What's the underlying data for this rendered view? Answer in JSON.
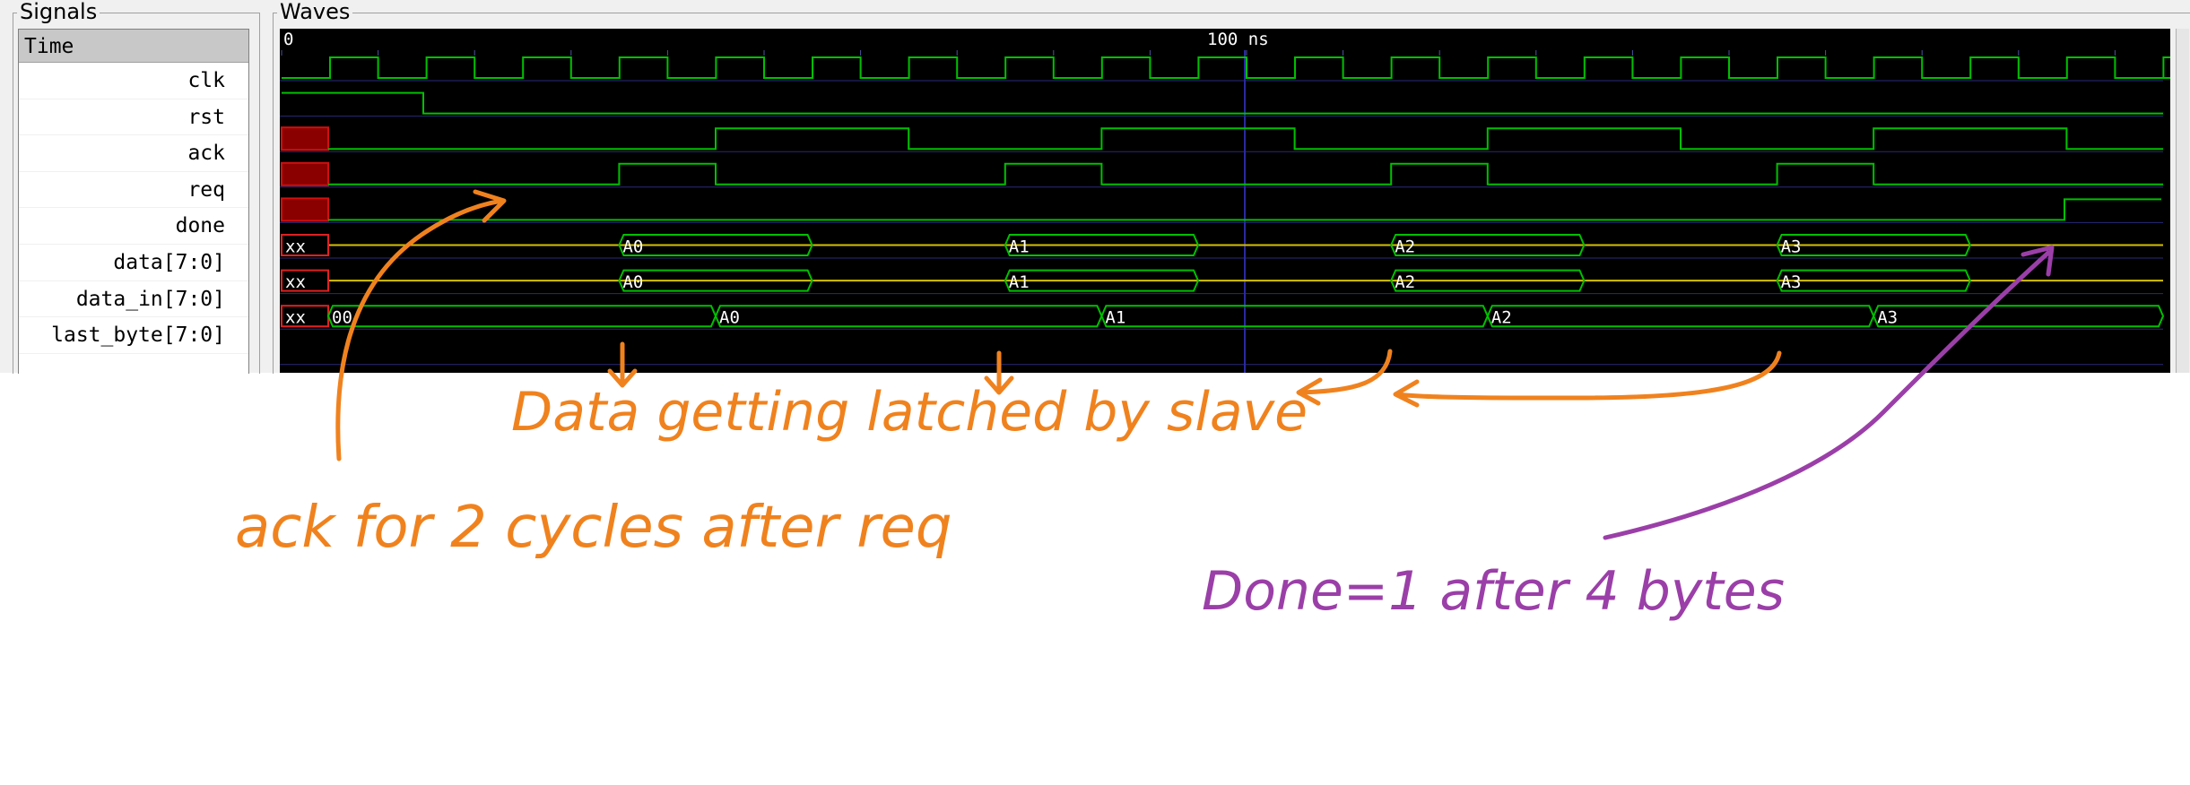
{
  "panels": {
    "signals_title": "Signals",
    "waves_title": "Waves"
  },
  "signals": {
    "header": "Time",
    "names": [
      "clk",
      "rst",
      "ack",
      "req",
      "done",
      "data[7:0]",
      "data_in[7:0]",
      "last_byte[7:0]"
    ]
  },
  "timeline": {
    "start_label": "0",
    "marker_label": "100 ns"
  },
  "waves": {
    "unknown_value": "xx",
    "data_values": [
      "A0",
      "A1",
      "A2",
      "A3"
    ],
    "data_in_values": [
      "A0",
      "A1",
      "A2",
      "A3"
    ],
    "last_byte_initial": "00",
    "last_byte_values": [
      "A0",
      "A1",
      "A2",
      "A3"
    ]
  },
  "annotations": {
    "ack_note": "ack for 2 cycles after req",
    "latch_note": "Data getting latched by slave",
    "done_note": "Done=1 after 4 bytes"
  },
  "colors": {
    "wave_background": "#000000",
    "signal_trace": "#00c000",
    "bus_undefined_line": "#d4c000",
    "unknown_marker": "#8a0000",
    "grid": "#2a2a7a",
    "orange_annotation": "#f0821e",
    "purple_annotation": "#9b3fa8"
  }
}
